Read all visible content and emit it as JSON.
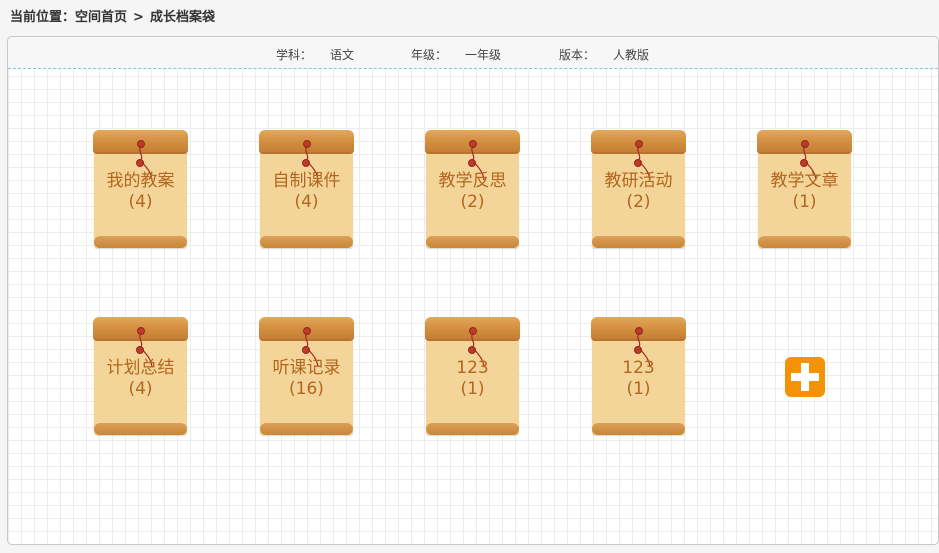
{
  "breadcrumb": {
    "prefix": "当前位置：",
    "home": "空间首页",
    "separator": ">",
    "current": "成长档案袋"
  },
  "info": {
    "subject_label": "学科：",
    "subject_value": "语文",
    "grade_label": "年级：",
    "grade_value": "一年级",
    "edition_label": "版本：",
    "edition_value": "人教版"
  },
  "folders": [
    {
      "title": "我的教案",
      "count": "(4)"
    },
    {
      "title": "自制课件",
      "count": "(4)"
    },
    {
      "title": "教学反思",
      "count": "(2)"
    },
    {
      "title": "教研活动",
      "count": "(2)"
    },
    {
      "title": "教学文章",
      "count": "(1)"
    },
    {
      "title": "计划总结",
      "count": "(4)"
    },
    {
      "title": "听课记录",
      "count": "(16)"
    },
    {
      "title": "123",
      "count": "(1)"
    },
    {
      "title": "123",
      "count": "(1)"
    }
  ],
  "icons": {
    "add": "plus-icon",
    "string": "string-tie-icon"
  },
  "colors": {
    "folder_text": "#b2661f",
    "folder_body": "#f3d59a",
    "folder_flap": "#d08c3c",
    "add_button": "#f39205",
    "divider": "#7fc4e0"
  }
}
